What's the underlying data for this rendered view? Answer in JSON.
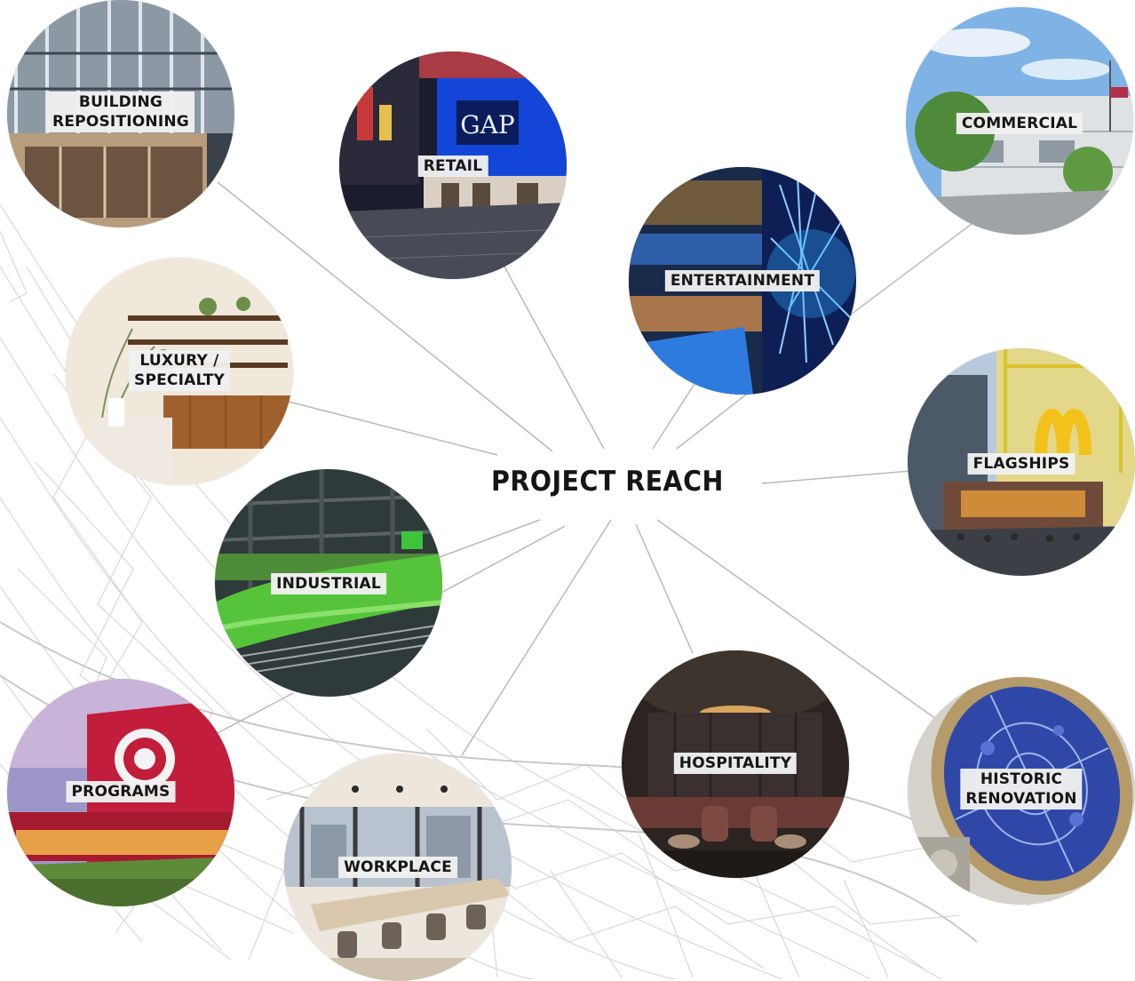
{
  "center": {
    "label": "PROJECT REACH"
  },
  "colors": {
    "connector": "#b9b9b9",
    "mesh": "#d6d6d6",
    "label_bg": "#f0f0f0",
    "label_text": "#161616",
    "title_text": "#151515"
  },
  "nodes": [
    {
      "id": "building-repositioning",
      "label": "BUILDING\nREPOSITIONING",
      "icon": "office-lobby-photo"
    },
    {
      "id": "retail",
      "label": "RETAIL",
      "icon": "gap-storefront-photo"
    },
    {
      "id": "entertainment",
      "label": "ENTERTAINMENT",
      "icon": "led-venue-photo"
    },
    {
      "id": "commercial",
      "label": "COMMERCIAL",
      "icon": "commercial-building-photo"
    },
    {
      "id": "luxury-specialty",
      "label": "LUXURY /\nSPECIALTY",
      "icon": "boutique-interior-photo"
    },
    {
      "id": "flagships",
      "label": "FLAGSHIPS",
      "icon": "times-square-flagship-photo"
    },
    {
      "id": "industrial",
      "label": "INDUSTRIAL",
      "icon": "conveyor-warehouse-photo"
    },
    {
      "id": "programs",
      "label": "PROGRAMS",
      "icon": "target-store-photo"
    },
    {
      "id": "workplace",
      "label": "WORKPLACE",
      "icon": "office-workspace-photo"
    },
    {
      "id": "hospitality",
      "label": "HOSPITALITY",
      "icon": "lounge-photo"
    },
    {
      "id": "historic-renovation",
      "label": "HISTORIC\nRENOVATION",
      "icon": "stained-glass-ceiling-photo"
    }
  ]
}
